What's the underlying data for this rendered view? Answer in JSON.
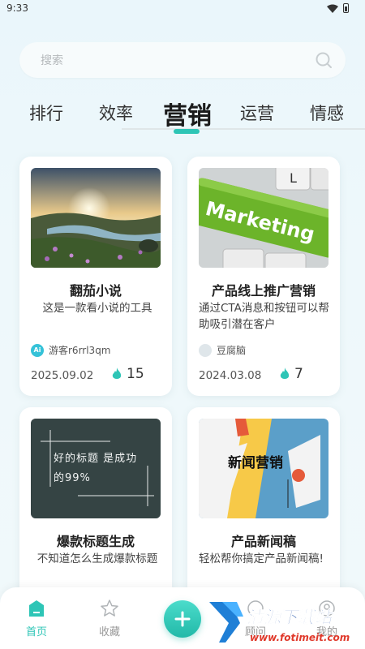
{
  "status_bar": {
    "time": "9:33"
  },
  "search": {
    "placeholder": "搜索"
  },
  "tabs": [
    {
      "label": "排行",
      "active": false
    },
    {
      "label": "效率",
      "active": false
    },
    {
      "label": "营销",
      "active": true
    },
    {
      "label": "运营",
      "active": false
    },
    {
      "label": "情感",
      "active": false
    }
  ],
  "cards": [
    {
      "title": "翻茄小说",
      "description": "这是一款看小说的工具",
      "author": "游客r6rrl3qm",
      "date": "2025.09.02",
      "hot": "15"
    },
    {
      "title": "产品线上推广营销",
      "description": "通过CTA消息和按钮可以帮助吸引潜在客户",
      "author": "豆腐脑",
      "date": "2024.03.08",
      "hot": "7",
      "image_text": "Marketing"
    },
    {
      "title": "爆款标题生成",
      "description": "不知道怎么生成爆款标题",
      "image_text": "好的标题 是成功的99%"
    },
    {
      "title": "产品新闻稿",
      "description": "轻松帮你搞定产品新闻稿!",
      "image_text": "新闻营销"
    }
  ],
  "bottom_nav": [
    {
      "label": "首页",
      "icon": "home-icon",
      "active": true
    },
    {
      "label": "收藏",
      "icon": "star-icon",
      "active": false
    },
    {
      "label": "顾问",
      "icon": "advisor-icon",
      "active": false
    },
    {
      "label": "我的",
      "icon": "profile-icon",
      "active": false
    }
  ],
  "watermark": {
    "title": "清源下载站",
    "url": "www.fotimeit.com"
  },
  "colors": {
    "accent": "#2ec5b6",
    "background": "#eaf6fb"
  }
}
